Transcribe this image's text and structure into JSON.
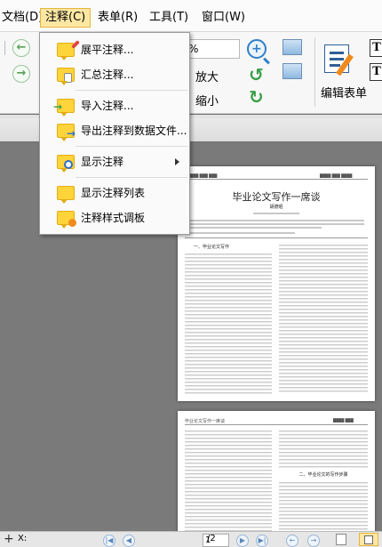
{
  "menubar": {
    "items": [
      "文档(D)",
      "注释(C)",
      "表单(R)",
      "工具(T)",
      "窗口(W)"
    ],
    "active_index": 1
  },
  "toolbar": {
    "zoom_value": "%",
    "enlarge_label": "放大",
    "shrink_label": "缩小",
    "edit_form_label": "编辑表单"
  },
  "dropdown": {
    "items": [
      {
        "label": "展平注释...",
        "icon": "flatten-comment-icon"
      },
      {
        "label": "汇总注释...",
        "icon": "summarize-comment-icon"
      },
      {
        "label": "导入注释...",
        "icon": "import-comment-icon"
      },
      {
        "label": "导出注释到数据文件...",
        "icon": "export-comment-icon"
      },
      {
        "label": "显示注释",
        "icon": "show-comment-icon",
        "submenu": true
      },
      {
        "label": "显示注释列表",
        "icon": "comment-list-icon"
      },
      {
        "label": "注释样式调板",
        "icon": "comment-style-icon"
      }
    ]
  },
  "document": {
    "page1_title": "毕业论文写作一席谈",
    "page1_author": "胡德昭",
    "page1_heading": "一、毕业论文写作",
    "page2_header_left": "毕业论文写作一席谈",
    "page2_heading": "二、毕业论文的写作步骤"
  },
  "statusbar": {
    "x_label": "X:",
    "page_value": "1",
    "page_total": "/2"
  }
}
